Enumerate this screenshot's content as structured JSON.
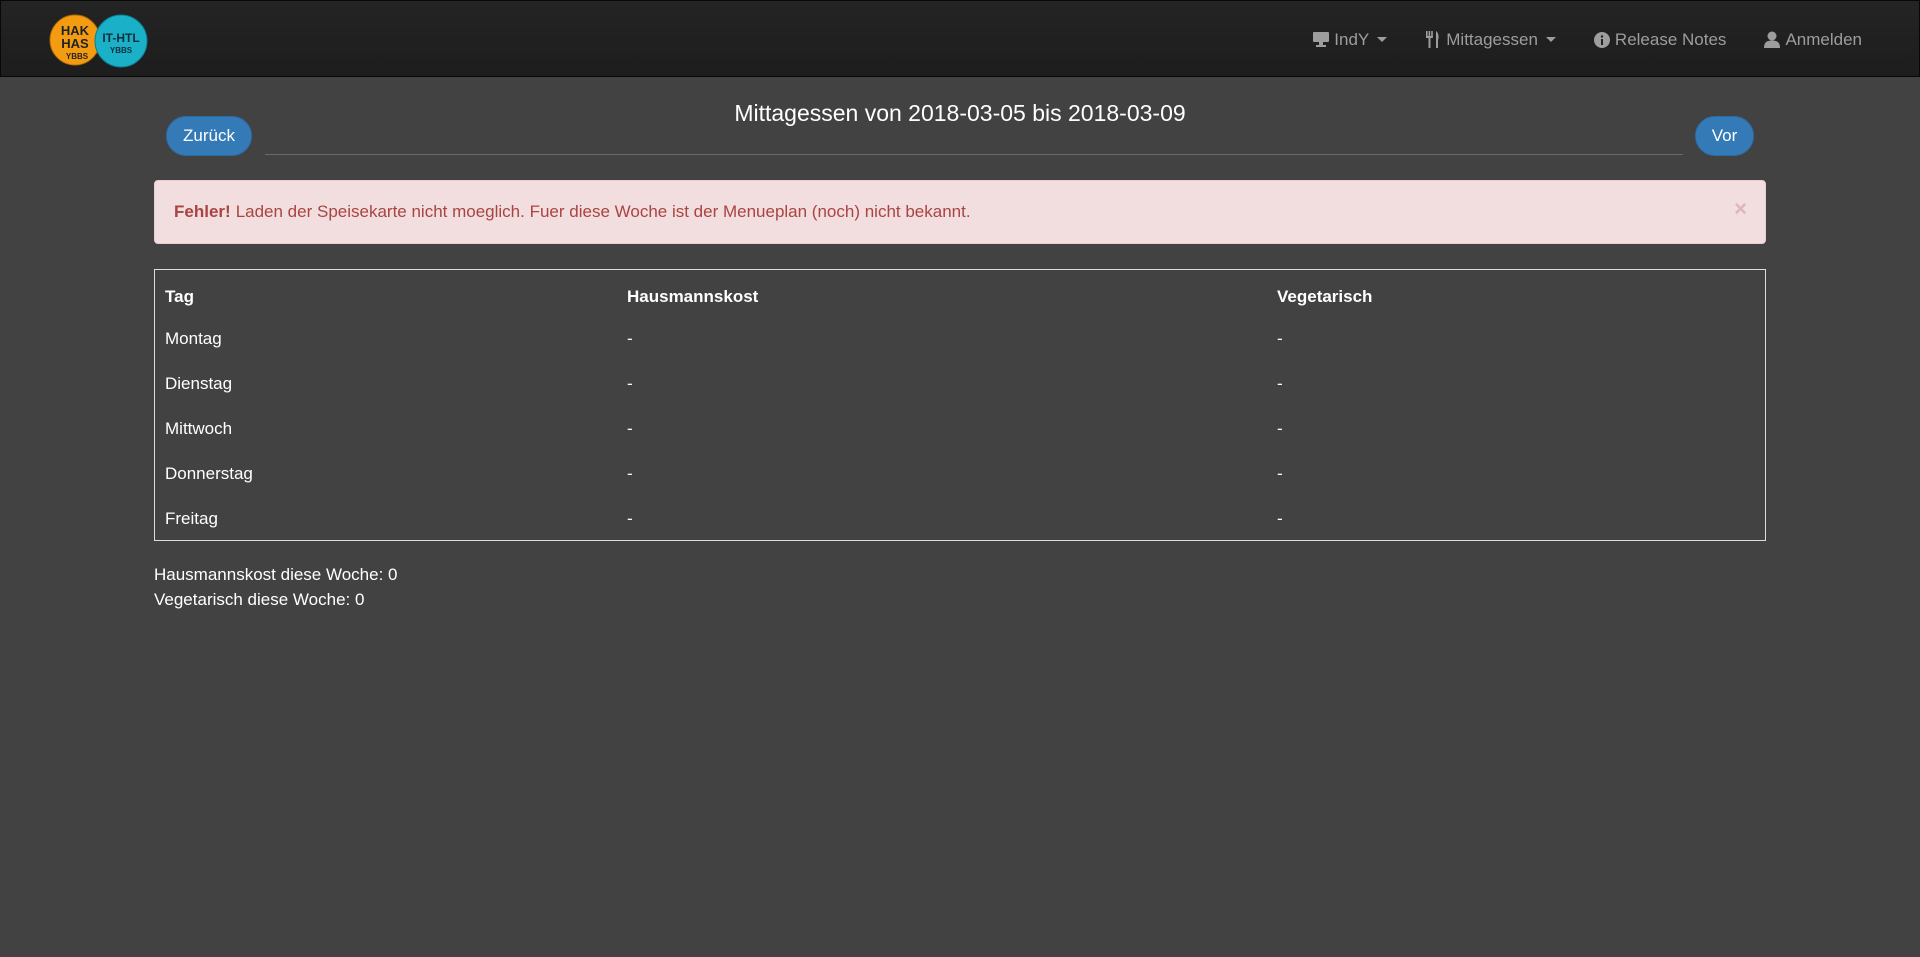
{
  "navbar": {
    "logo": {
      "left_text_lines": [
        "HAK",
        "HAS",
        "YBBS"
      ],
      "right_text_lines": [
        "IT-HTL",
        "YBBS"
      ],
      "left_color": "#f39c12",
      "right_color": "#1ab0c8"
    },
    "items": [
      {
        "label": "IndY",
        "icon": "monitor-icon",
        "dropdown": true
      },
      {
        "label": "Mittagessen",
        "icon": "cutlery-icon",
        "dropdown": true
      },
      {
        "label": "Release Notes",
        "icon": "info-icon",
        "dropdown": false
      },
      {
        "label": "Anmelden",
        "icon": "user-icon",
        "dropdown": false
      }
    ]
  },
  "week": {
    "title": "Mittagessen von 2018-03-05 bis 2018-03-09",
    "back_label": "Zurück",
    "forward_label": "Vor"
  },
  "alert": {
    "strong": "Fehler!",
    "message": "Laden der Speisekarte nicht moeglich. Fuer diese Woche ist der Menueplan (noch) nicht bekannt.",
    "close_symbol": "×"
  },
  "table": {
    "headers": [
      "Tag",
      "Hausmannskost",
      "Vegetarisch"
    ],
    "rows": [
      {
        "day": "Montag",
        "home": "-",
        "veg": "-"
      },
      {
        "day": "Dienstag",
        "home": "-",
        "veg": "-"
      },
      {
        "day": "Mittwoch",
        "home": "-",
        "veg": "-"
      },
      {
        "day": "Donnerstag",
        "home": "-",
        "veg": "-"
      },
      {
        "day": "Freitag",
        "home": "-",
        "veg": "-"
      }
    ]
  },
  "stats": {
    "home_line": "Hausmannskost diese Woche: 0",
    "veg_line": "Vegetarisch diese Woche: 0"
  },
  "colors": {
    "background": "#424242",
    "navbar": "#222222",
    "primary_button": "#337ab7",
    "alert_bg": "#f2dede",
    "alert_text": "#a94442"
  }
}
